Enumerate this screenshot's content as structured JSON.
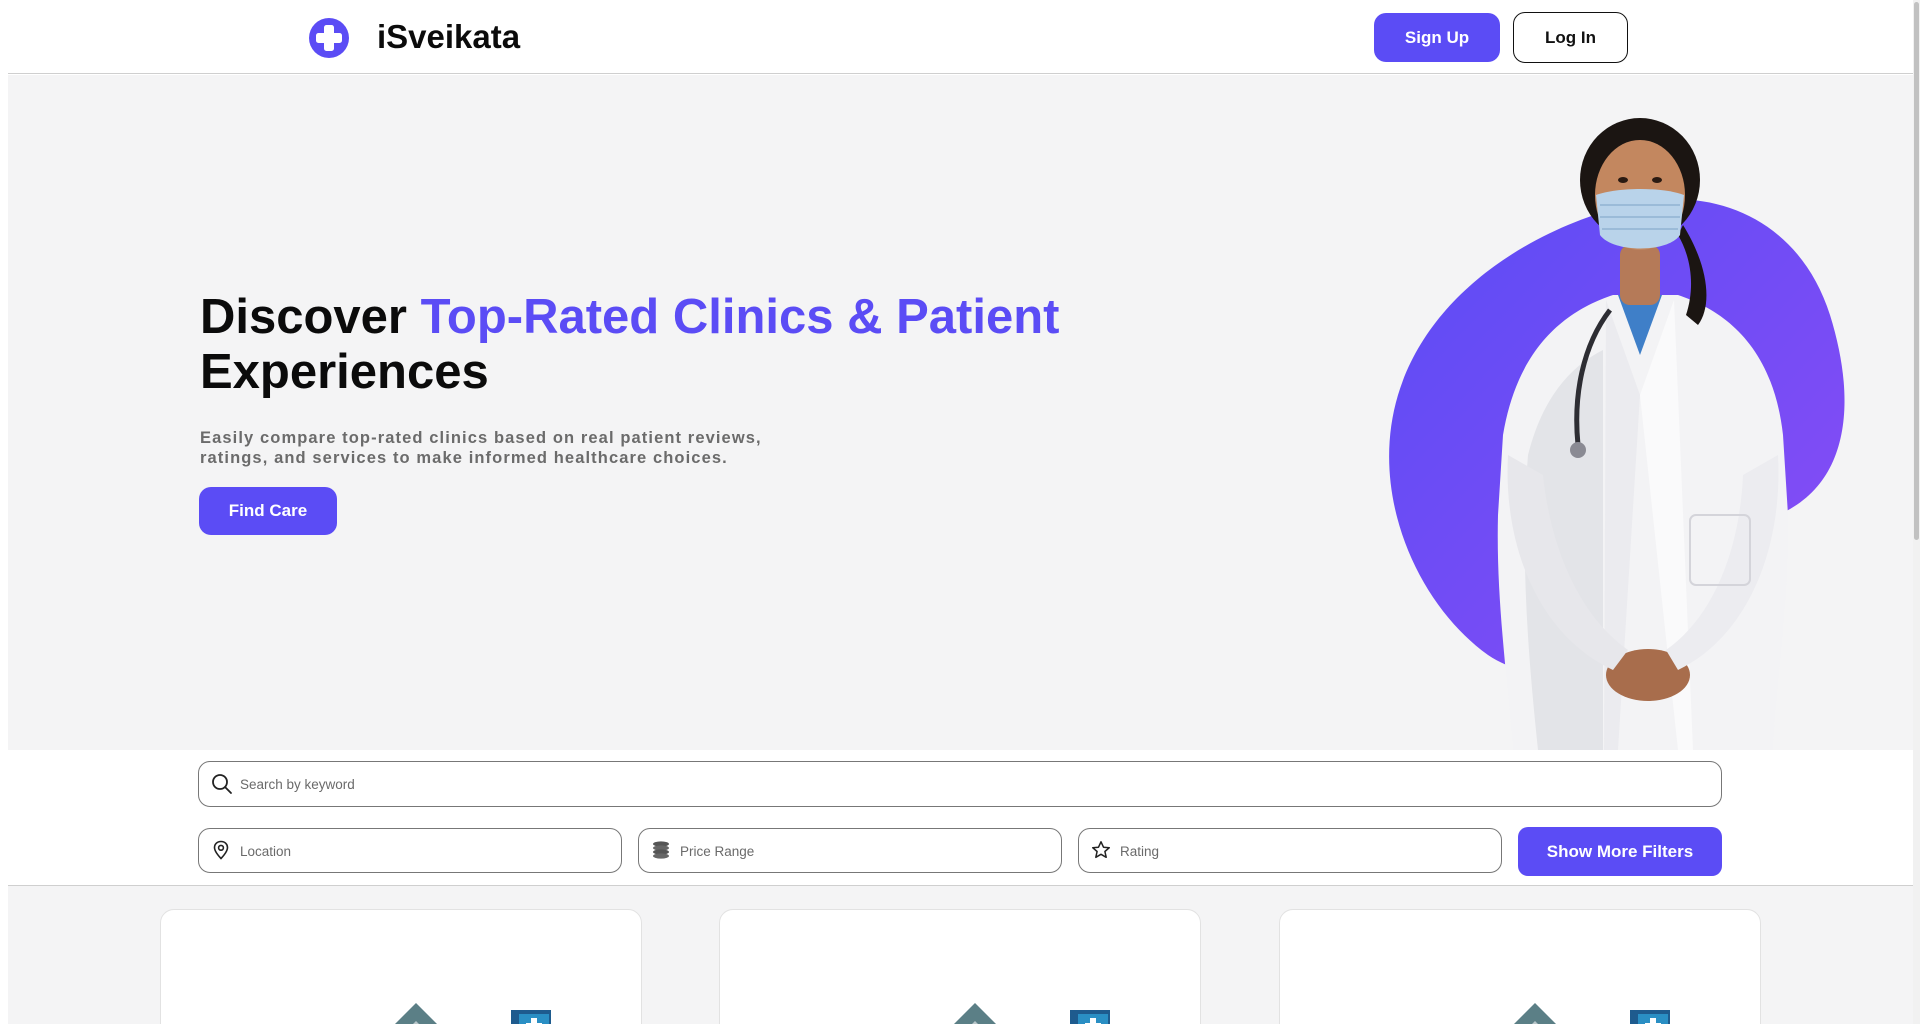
{
  "header": {
    "brand": "iSveikata",
    "logo_icon": "medical-cross-icon",
    "signup_label": "Sign Up",
    "login_label": "Log In"
  },
  "hero": {
    "title_plain": "Discover ",
    "title_accent": "Top-Rated Clinics & Patient",
    "title_line2": "Experiences",
    "subtitle": "Easily compare top-rated clinics based on real patient reviews, ratings, and services to make informed healthcare choices.",
    "cta_label": "Find Care",
    "image": "doctor-in-mask-illustration"
  },
  "filters": {
    "search": {
      "placeholder": "Search by keyword",
      "value": "",
      "icon": "search-icon"
    },
    "location": {
      "placeholder": "Location",
      "value": "",
      "icon": "map-pin-icon"
    },
    "price": {
      "placeholder": "Price Range",
      "value": "",
      "icon": "coins-icon"
    },
    "rating": {
      "placeholder": "Rating",
      "value": "",
      "icon": "star-icon"
    },
    "more_label": "Show More Filters"
  },
  "results": {
    "cards": [
      {
        "image": "clinic-building-icon"
      },
      {
        "image": "clinic-building-icon"
      },
      {
        "image": "clinic-building-icon"
      }
    ]
  },
  "colors": {
    "accent": "#5b4cf5",
    "hero_bg": "#f4f4f5",
    "blob_gradient": [
      "#5b4cf5",
      "#8a4cf5"
    ]
  }
}
